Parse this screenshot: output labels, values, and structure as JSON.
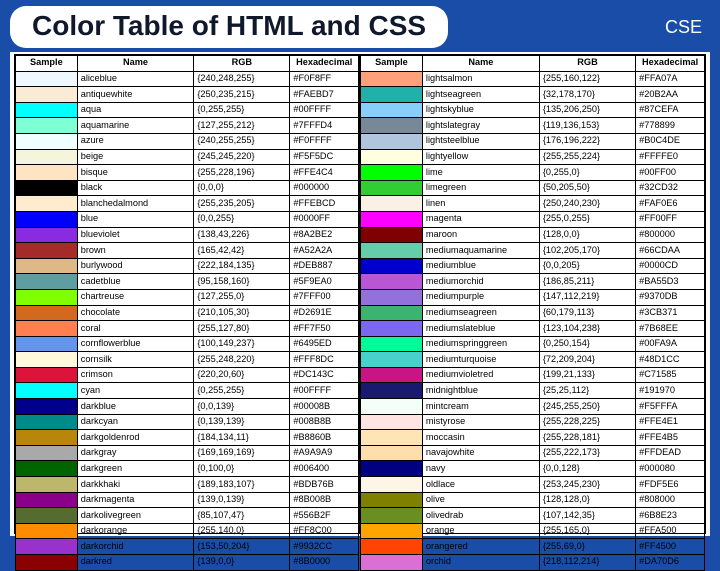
{
  "header": {
    "title": "Color Table of HTML and CSS",
    "brand": "CSE"
  },
  "columns": {
    "sample": "Sample",
    "name": "Name",
    "rgb": "RGB",
    "hex": "Hexadecimal"
  },
  "colors_left": [
    {
      "name": "aliceblue",
      "rgb": "{240,248,255}",
      "hex": "#F0F8FF",
      "swatch": "#F0F8FF"
    },
    {
      "name": "antiquewhite",
      "rgb": "{250,235,215}",
      "hex": "#FAEBD7",
      "swatch": "#FAEBD7"
    },
    {
      "name": "aqua",
      "rgb": "{0,255,255}",
      "hex": "#00FFFF",
      "swatch": "#00FFFF"
    },
    {
      "name": "aquamarine",
      "rgb": "{127,255,212}",
      "hex": "#7FFFD4",
      "swatch": "#7FFFD4"
    },
    {
      "name": "azure",
      "rgb": "{240,255,255}",
      "hex": "#F0FFFF",
      "swatch": "#F0FFFF"
    },
    {
      "name": "beige",
      "rgb": "{245,245,220}",
      "hex": "#F5F5DC",
      "swatch": "#F5F5DC"
    },
    {
      "name": "bisque",
      "rgb": "{255,228,196}",
      "hex": "#FFE4C4",
      "swatch": "#FFE4C4"
    },
    {
      "name": "black",
      "rgb": "{0,0,0}",
      "hex": "#000000",
      "swatch": "#000000"
    },
    {
      "name": "blanchedalmond",
      "rgb": "{255,235,205}",
      "hex": "#FFEBCD",
      "swatch": "#FFEBCD"
    },
    {
      "name": "blue",
      "rgb": "{0,0,255}",
      "hex": "#0000FF",
      "swatch": "#0000FF"
    },
    {
      "name": "blueviolet",
      "rgb": "{138,43,226}",
      "hex": "#8A2BE2",
      "swatch": "#8A2BE2"
    },
    {
      "name": "brown",
      "rgb": "{165,42,42}",
      "hex": "#A52A2A",
      "swatch": "#A52A2A"
    },
    {
      "name": "burlywood",
      "rgb": "{222,184,135}",
      "hex": "#DEB887",
      "swatch": "#DEB887"
    },
    {
      "name": "cadetblue",
      "rgb": "{95,158,160}",
      "hex": "#5F9EA0",
      "swatch": "#5F9EA0"
    },
    {
      "name": "chartreuse",
      "rgb": "{127,255,0}",
      "hex": "#7FFF00",
      "swatch": "#7FFF00"
    },
    {
      "name": "chocolate",
      "rgb": "{210,105,30}",
      "hex": "#D2691E",
      "swatch": "#D2691E"
    },
    {
      "name": "coral",
      "rgb": "{255,127,80}",
      "hex": "#FF7F50",
      "swatch": "#FF7F50"
    },
    {
      "name": "cornflowerblue",
      "rgb": "{100,149,237}",
      "hex": "#6495ED",
      "swatch": "#6495ED"
    },
    {
      "name": "cornsilk",
      "rgb": "{255,248,220}",
      "hex": "#FFF8DC",
      "swatch": "#FFF8DC"
    },
    {
      "name": "crimson",
      "rgb": "{220,20,60}",
      "hex": "#DC143C",
      "swatch": "#DC143C"
    },
    {
      "name": "cyan",
      "rgb": "{0,255,255}",
      "hex": "#00FFFF",
      "swatch": "#00FFFF"
    },
    {
      "name": "darkblue",
      "rgb": "{0,0,139}",
      "hex": "#00008B",
      "swatch": "#00008B"
    },
    {
      "name": "darkcyan",
      "rgb": "{0,139,139}",
      "hex": "#008B8B",
      "swatch": "#008B8B"
    },
    {
      "name": "darkgoldenrod",
      "rgb": "{184,134,11}",
      "hex": "#B8860B",
      "swatch": "#B8860B"
    },
    {
      "name": "darkgray",
      "rgb": "{169,169,169}",
      "hex": "#A9A9A9",
      "swatch": "#A9A9A9"
    },
    {
      "name": "darkgreen",
      "rgb": "{0,100,0}",
      "hex": "#006400",
      "swatch": "#006400"
    },
    {
      "name": "darkkhaki",
      "rgb": "{189,183,107}",
      "hex": "#BDB76B",
      "swatch": "#BDB76B"
    },
    {
      "name": "darkmagenta",
      "rgb": "{139,0,139}",
      "hex": "#8B008B",
      "swatch": "#8B008B"
    },
    {
      "name": "darkolivegreen",
      "rgb": "{85,107,47}",
      "hex": "#556B2F",
      "swatch": "#556B2F"
    },
    {
      "name": "darkorange",
      "rgb": "{255,140,0}",
      "hex": "#FF8C00",
      "swatch": "#FF8C00"
    },
    {
      "name": "darkorchid",
      "rgb": "{153,50,204}",
      "hex": "#9932CC",
      "swatch": "#9932CC"
    },
    {
      "name": "darkred",
      "rgb": "{139,0,0}",
      "hex": "#8B0000",
      "swatch": "#8B0000"
    }
  ],
  "colors_right": [
    {
      "name": "lightsalmon",
      "rgb": "{255,160,122}",
      "hex": "#FFA07A",
      "swatch": "#FFA07A"
    },
    {
      "name": "lightseagreen",
      "rgb": "{32,178,170}",
      "hex": "#20B2AA",
      "swatch": "#20B2AA"
    },
    {
      "name": "lightskyblue",
      "rgb": "{135,206,250}",
      "hex": "#87CEFA",
      "swatch": "#87CEFA"
    },
    {
      "name": "lightslategray",
      "rgb": "{119,136,153}",
      "hex": "#778899",
      "swatch": "#778899"
    },
    {
      "name": "lightsteelblue",
      "rgb": "{176,196,222}",
      "hex": "#B0C4DE",
      "swatch": "#B0C4DE"
    },
    {
      "name": "lightyellow",
      "rgb": "{255,255,224}",
      "hex": "#FFFFE0",
      "swatch": "#FFFFE0"
    },
    {
      "name": "lime",
      "rgb": "{0,255,0}",
      "hex": "#00FF00",
      "swatch": "#00FF00"
    },
    {
      "name": "limegreen",
      "rgb": "{50,205,50}",
      "hex": "#32CD32",
      "swatch": "#32CD32"
    },
    {
      "name": "linen",
      "rgb": "{250,240,230}",
      "hex": "#FAF0E6",
      "swatch": "#FAF0E6"
    },
    {
      "name": "magenta",
      "rgb": "{255,0,255}",
      "hex": "#FF00FF",
      "swatch": "#FF00FF"
    },
    {
      "name": "maroon",
      "rgb": "{128,0,0}",
      "hex": "#800000",
      "swatch": "#800000"
    },
    {
      "name": "mediumaquamarine",
      "rgb": "{102,205,170}",
      "hex": "#66CDAA",
      "swatch": "#66CDAA"
    },
    {
      "name": "mediumblue",
      "rgb": "{0,0,205}",
      "hex": "#0000CD",
      "swatch": "#0000CD"
    },
    {
      "name": "mediumorchid",
      "rgb": "{186,85,211}",
      "hex": "#BA55D3",
      "swatch": "#BA55D3"
    },
    {
      "name": "mediumpurple",
      "rgb": "{147,112,219}",
      "hex": "#9370DB",
      "swatch": "#9370DB"
    },
    {
      "name": "mediumseagreen",
      "rgb": "{60,179,113}",
      "hex": "#3CB371",
      "swatch": "#3CB371"
    },
    {
      "name": "mediumslateblue",
      "rgb": "{123,104,238}",
      "hex": "#7B68EE",
      "swatch": "#7B68EE"
    },
    {
      "name": "mediumspringgreen",
      "rgb": "{0,250,154}",
      "hex": "#00FA9A",
      "swatch": "#00FA9A"
    },
    {
      "name": "mediumturquoise",
      "rgb": "{72,209,204}",
      "hex": "#48D1CC",
      "swatch": "#48D1CC"
    },
    {
      "name": "mediumvioletred",
      "rgb": "{199,21,133}",
      "hex": "#C71585",
      "swatch": "#C71585"
    },
    {
      "name": "midnightblue",
      "rgb": "{25,25,112}",
      "hex": "#191970",
      "swatch": "#191970"
    },
    {
      "name": "mintcream",
      "rgb": "{245,255,250}",
      "hex": "#F5FFFA",
      "swatch": "#F5FFFA"
    },
    {
      "name": "mistyrose",
      "rgb": "{255,228,225}",
      "hex": "#FFE4E1",
      "swatch": "#FFE4E1"
    },
    {
      "name": "moccasin",
      "rgb": "{255,228,181}",
      "hex": "#FFE4B5",
      "swatch": "#FFE4B5"
    },
    {
      "name": "navajowhite",
      "rgb": "{255,222,173}",
      "hex": "#FFDEAD",
      "swatch": "#FFDEAD"
    },
    {
      "name": "navy",
      "rgb": "{0,0,128}",
      "hex": "#000080",
      "swatch": "#000080"
    },
    {
      "name": "oldlace",
      "rgb": "{253,245,230}",
      "hex": "#FDF5E6",
      "swatch": "#FDF5E6"
    },
    {
      "name": "olive",
      "rgb": "{128,128,0}",
      "hex": "#808000",
      "swatch": "#808000"
    },
    {
      "name": "olivedrab",
      "rgb": "{107,142,35}",
      "hex": "#6B8E23",
      "swatch": "#6B8E23"
    },
    {
      "name": "orange",
      "rgb": "{255,165,0}",
      "hex": "#FFA500",
      "swatch": "#FFA500"
    },
    {
      "name": "orangered",
      "rgb": "{255,69,0}",
      "hex": "#FF4500",
      "swatch": "#FF4500"
    },
    {
      "name": "orchid",
      "rgb": "{218,112,214}",
      "hex": "#DA70D6",
      "swatch": "#DA70D6"
    }
  ]
}
